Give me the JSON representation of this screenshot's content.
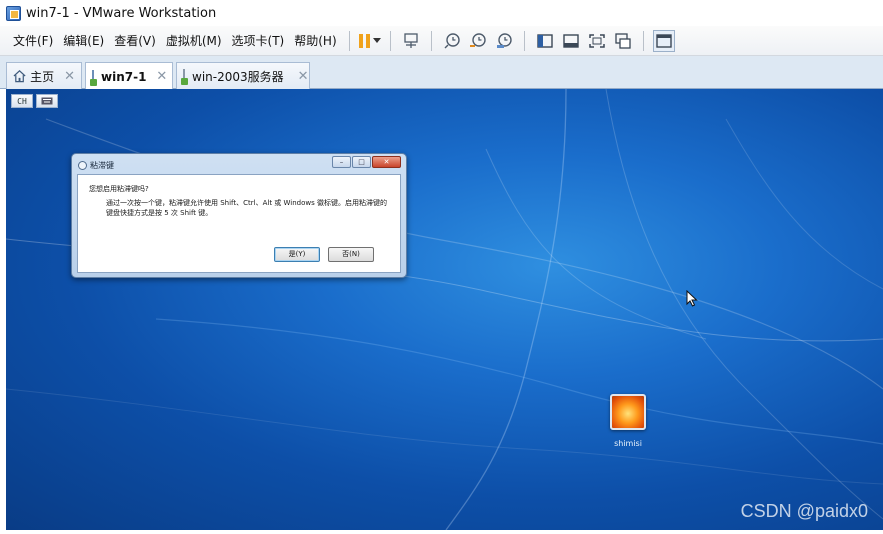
{
  "window": {
    "title": "win7-1 - VMware Workstation"
  },
  "menu": {
    "items": [
      "文件(F)",
      "编辑(E)",
      "查看(V)",
      "虚拟机(M)",
      "选项卡(T)",
      "帮助(H)"
    ]
  },
  "toolbar": {
    "icons": [
      "pause-icon",
      "send-ctrl-alt-del-icon",
      "snapshot-take-icon",
      "snapshot-revert-icon",
      "snapshot-manager-icon",
      "console-view-icon",
      "thumbnail-bar-icon",
      "fullscreen-icon",
      "unity-icon",
      "library-view-icon"
    ],
    "pause_color": "#f0a21c"
  },
  "tabs": [
    {
      "label": "主页",
      "active": false
    },
    {
      "label": "win7-1",
      "active": true
    },
    {
      "label": "win-2003服务器",
      "active": false
    }
  ],
  "vm_screen": {
    "chips": [
      "CH",
      "keyboard-icon"
    ],
    "user": {
      "name": "shimisi"
    },
    "wallpaper_color": "#1a6dcb"
  },
  "dialog": {
    "title": "粘滞键",
    "question": "您想启用粘滞键吗?",
    "detail": "通过一次按一个键，粘滞键允许使用 Shift、Ctrl、Alt 或 Windows 徽标键。启用粘滞键的键盘快捷方式是按 5 次 Shift 键。",
    "yes_label": "是(Y)",
    "no_label": "否(N)"
  },
  "watermark": "CSDN @paidx0"
}
